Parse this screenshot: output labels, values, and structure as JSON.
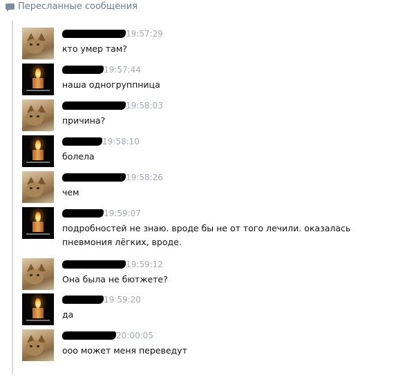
{
  "header": {
    "title": "Пересланные сообщения",
    "icon": "speech-bubble-icon",
    "icon_color": "#7b8da3"
  },
  "messages": [
    {
      "avatar": "cat",
      "time": "19:57:29",
      "text": "кто умер там?"
    },
    {
      "avatar": "candle",
      "time": "19:57:44",
      "text": "наша одногруппница"
    },
    {
      "avatar": "cat",
      "time": "19:58:03",
      "text": "причина?"
    },
    {
      "avatar": "candle",
      "time": "19:58:10",
      "text": "болела"
    },
    {
      "avatar": "cat",
      "time": "19:58:26",
      "text": "чем"
    },
    {
      "avatar": "candle",
      "time": "19:59:07",
      "text": "подробностей не знаю. вроде бы не от того лечили. оказалась пневмония лёгких, вроде."
    },
    {
      "avatar": "cat",
      "time": "19:59:12",
      "text": "Она была не бютжете?"
    },
    {
      "avatar": "candle",
      "time": "19:59:20",
      "text": "да"
    },
    {
      "avatar": "cat",
      "time": "20:00:05",
      "text": "ооо может меня переведут"
    }
  ]
}
